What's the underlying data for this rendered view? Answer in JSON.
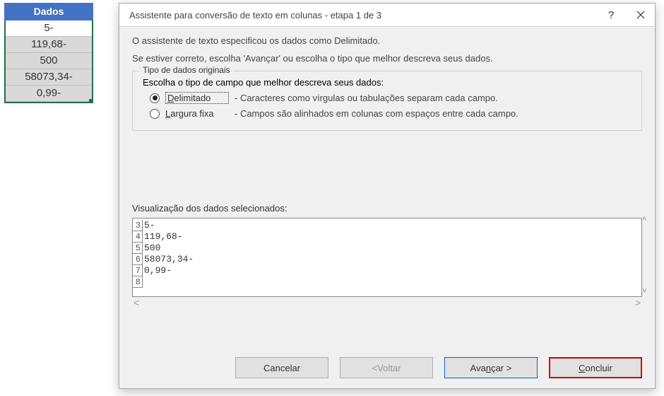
{
  "sheet": {
    "header": "Dados",
    "cells": [
      "5-",
      "119,68-",
      "500",
      "58073,34-",
      "0,99-"
    ]
  },
  "dialog": {
    "title": "Assistente para conversão de texto em colunas - etapa 1 de 3",
    "intro1": "O assistente de texto especificou os dados como Delimitado.",
    "intro2": "Se estiver correto, escolha 'Avançar' ou escolha o tipo que melhor descreva seus dados.",
    "groupTitle": "Tipo de dados originais",
    "groupPrompt": "Escolha o tipo de campo que melhor descreva seus dados:",
    "opt1": {
      "prefix": "D",
      "rest": "elimitado",
      "desc": "- Caracteres como vírgulas ou tabulações separam cada campo.",
      "checked": true
    },
    "opt2": {
      "prefix": "L",
      "rest": "argura fixa",
      "desc": "- Campos são alinhados em colunas com espaços entre cada campo.",
      "checked": false
    },
    "previewLabel": "Visualização dos dados selecionados:",
    "preview": [
      {
        "n": "3",
        "v": "5-"
      },
      {
        "n": "4",
        "v": "119,68-"
      },
      {
        "n": "5",
        "v": "500"
      },
      {
        "n": "6",
        "v": "58073,34-"
      },
      {
        "n": "7",
        "v": "0,99-"
      },
      {
        "n": "8",
        "v": ""
      }
    ],
    "buttons": {
      "cancel": "Cancelar",
      "backPrefix": "< ",
      "backLabel": "Voltar",
      "nextPrefix": "Ava",
      "nextUnder": "n",
      "nextRest": "çar >",
      "finishPrefix": "C",
      "finishRest": "oncluir"
    }
  }
}
